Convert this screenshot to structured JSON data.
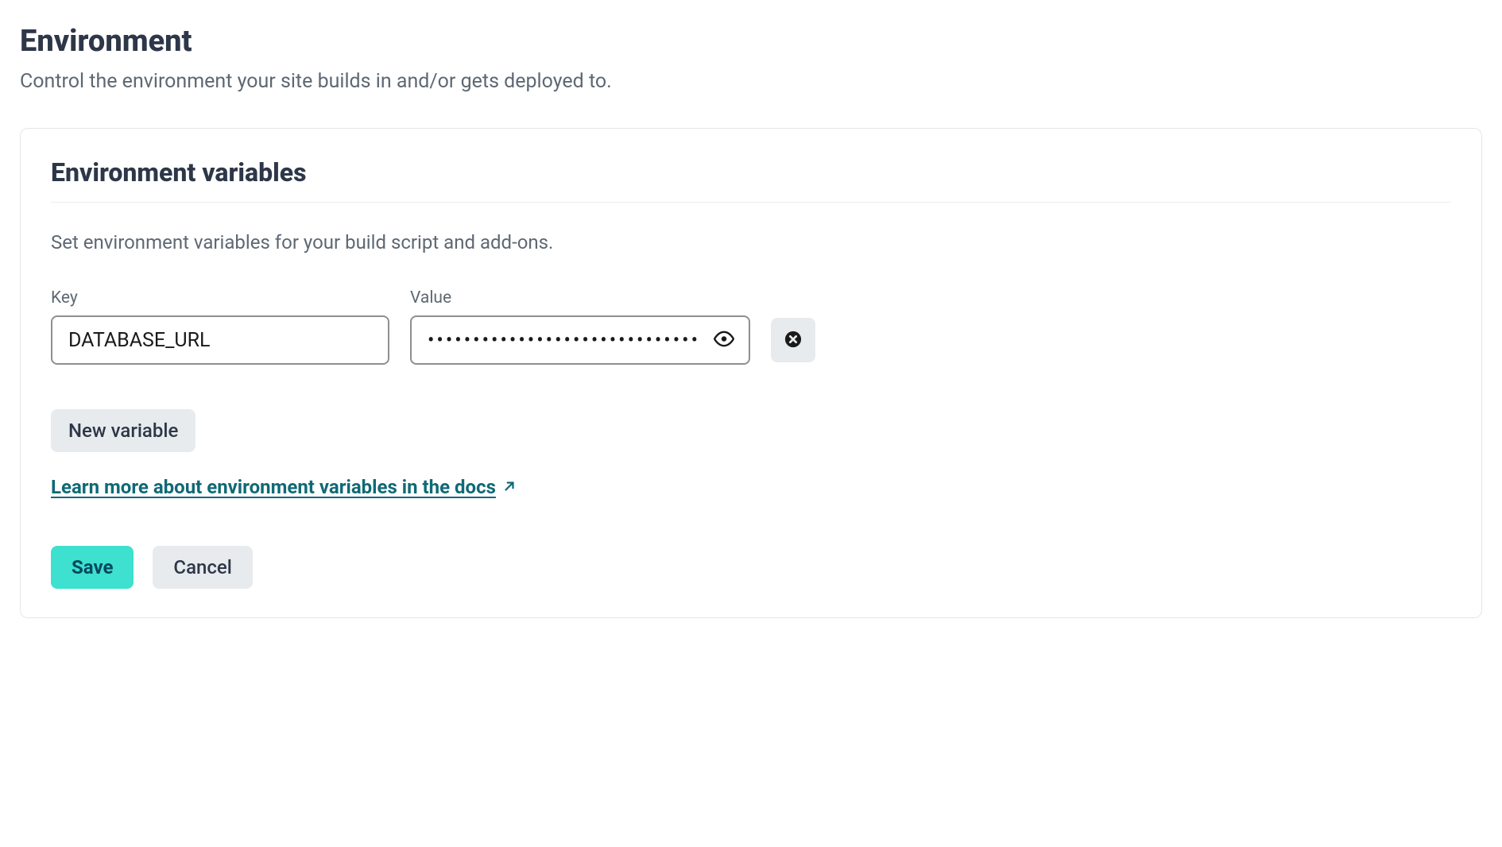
{
  "page": {
    "title": "Environment",
    "subtitle": "Control the environment your site builds in and/or gets deployed to."
  },
  "card": {
    "title": "Environment variables",
    "description": "Set environment variables for your build script and add-ons.",
    "labels": {
      "key": "Key",
      "value": "Value"
    },
    "vars": [
      {
        "key": "DATABASE_URL",
        "value": "••••••••••••••••••••••••••••••"
      }
    ],
    "new_variable_label": "New variable",
    "docs_link_label": "Learn more about environment variables in the docs",
    "save_label": "Save",
    "cancel_label": "Cancel"
  }
}
